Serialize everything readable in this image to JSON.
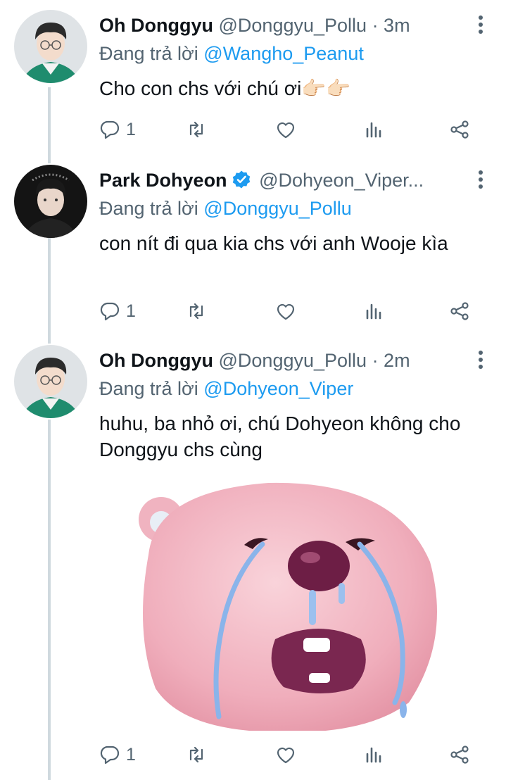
{
  "tweets": [
    {
      "name": "Oh Donggyu",
      "verified": false,
      "handle": "@Donggyu_Pollu",
      "time": "· 3m",
      "replying_prefix": "Đang trả lời",
      "replying_to": "@Wangho_Peanut",
      "text": "Cho con chs với chú ơi👉🏻👉🏻",
      "reply_count": "1",
      "avatar_icon": "user-avatar-photo"
    },
    {
      "name": "Park Dohyeon",
      "verified": true,
      "handle": "@Dohyeon_Viper...",
      "time": "",
      "replying_prefix": "Đang trả lời",
      "replying_to": "@Donggyu_Pollu",
      "text": "con nít đi qua kia chs với anh Wooje kìa",
      "reply_count": "1",
      "avatar_icon": "user-avatar-photo"
    },
    {
      "name": "Oh Donggyu",
      "verified": false,
      "handle": "@Donggyu_Pollu",
      "time": "· 2m",
      "replying_prefix": "Đang trả lời",
      "replying_to": "@Dohyeon_Viper",
      "text": "huhu, ba nhỏ ơi, chú Dohyeon không cho Donggyu chs cùng",
      "reply_count": "1",
      "avatar_icon": "user-avatar-photo",
      "media": "crying-pink-beaver-sticker"
    }
  ],
  "colors": {
    "accent": "#1d9bf0",
    "secondary_text": "#536471",
    "thread_line": "#cfd9de",
    "media_pink": "#f2b3c0"
  }
}
